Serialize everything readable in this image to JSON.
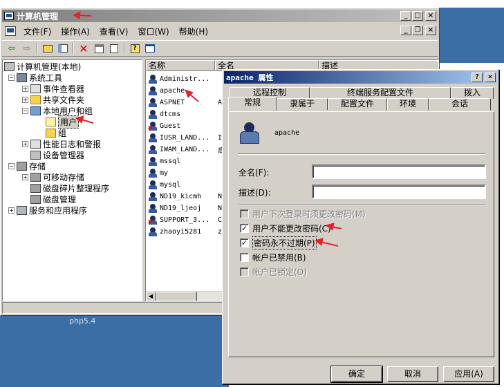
{
  "desktop": {
    "text": "php5.4"
  },
  "main_window": {
    "title": "计算机管理",
    "menu": [
      "文件(F)",
      "操作(A)",
      "查看(V)",
      "窗口(W)",
      "帮助(H)"
    ],
    "toolbar_icons": [
      "back-arrow-icon",
      "forward-arrow-icon",
      "up-folder-icon",
      "show-tree-icon",
      "delete-icon",
      "properties-icon",
      "export-icon",
      "help-icon",
      "mmc-view-icon"
    ]
  },
  "tree": {
    "root": "计算机管理(本地)",
    "system_tools": "系统工具",
    "event_viewer": "事件查看器",
    "shared_folders": "共享文件夹",
    "local_users": "本地用户和组",
    "users": "用户",
    "groups": "组",
    "perf_logs": "性能日志和警报",
    "device_manager": "设备管理器",
    "storage": "存储",
    "removable": "可移动存储",
    "defrag": "磁盘碎片整理程序",
    "disk_mgmt": "磁盘管理",
    "services": "服务和应用程序"
  },
  "list": {
    "columns": [
      "名称",
      "全名",
      "描述"
    ],
    "rows": [
      {
        "name": "Administr...",
        "full": "",
        "disabled": false
      },
      {
        "name": "apache",
        "full": "",
        "disabled": false
      },
      {
        "name": "ASPNET",
        "full": "A",
        "disabled": false
      },
      {
        "name": "dtcms",
        "full": "",
        "disabled": false
      },
      {
        "name": "Guest",
        "full": "",
        "disabled": true
      },
      {
        "name": "IUSR_LAND...",
        "full": "I",
        "disabled": false
      },
      {
        "name": "IWAM_LAND...",
        "full": "启",
        "disabled": false
      },
      {
        "name": "mssql",
        "full": "",
        "disabled": false
      },
      {
        "name": "my",
        "full": "",
        "disabled": false
      },
      {
        "name": "mysql",
        "full": "",
        "disabled": false
      },
      {
        "name": "ND19_kicmh",
        "full": "N",
        "disabled": false
      },
      {
        "name": "ND19_ljeoj",
        "full": "N",
        "disabled": false
      },
      {
        "name": "SUPPORT_3...",
        "full": "C",
        "disabled": true
      },
      {
        "name": "zhaoyi5281",
        "full": "z",
        "disabled": false
      }
    ]
  },
  "dialog": {
    "title": "apache 属性",
    "help_btn": "?",
    "close_btn": "×",
    "tabs_back": [
      "远程控制",
      "终端服务配置文件",
      "拨入"
    ],
    "tabs_front": [
      "常规",
      "隶属于",
      "配置文件",
      "环境",
      "会话"
    ],
    "username": "apache",
    "fullname_label": "全名(F):",
    "fullname_value": "",
    "desc_label": "描述(D):",
    "desc_value": "",
    "checkboxes": [
      {
        "label": "用户下次登录时须更改密码(M)",
        "checked": false,
        "enabled": false
      },
      {
        "label": "用户不能更改密码(C)",
        "checked": true,
        "enabled": true
      },
      {
        "label": "密码永不过期(P)",
        "checked": true,
        "enabled": true
      },
      {
        "label": "帐户已禁用(B)",
        "checked": false,
        "enabled": true
      },
      {
        "label": "帐户已锁定(O)",
        "checked": false,
        "enabled": false
      }
    ],
    "buttons": {
      "ok": "确定",
      "cancel": "取消",
      "apply": "应用(A)"
    }
  },
  "colors": {
    "title_active": "#0a246a",
    "annotation_arrow": "#e8202a",
    "desktop": "#3a6ea5"
  }
}
